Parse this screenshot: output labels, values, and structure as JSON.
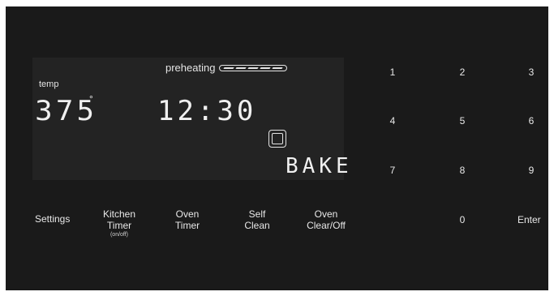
{
  "display": {
    "preheat_label": "preheating",
    "temp_label": "temp",
    "temperature": "375",
    "degree_symbol": "°",
    "clock": "12:30",
    "mode": "BAKE"
  },
  "function_keys": {
    "settings": "Settings",
    "kitchen_timer_line1": "Kitchen",
    "kitchen_timer_line2": "Timer",
    "kitchen_timer_sub": "(on/off)",
    "oven_timer_line1": "Oven",
    "oven_timer_line2": "Timer",
    "self_clean_line1": "Self",
    "self_clean_line2": "Clean",
    "oven_clear_line1": "Oven",
    "oven_clear_line2": "Clear/Off"
  },
  "keypad": {
    "k1": "1",
    "k2": "2",
    "k3": "3",
    "k4": "4",
    "k5": "5",
    "k6": "6",
    "k7": "7",
    "k8": "8",
    "k9": "9",
    "k0": "0",
    "enter": "Enter"
  },
  "colors": {
    "panel": "#1a1a1a",
    "display": "#232323",
    "text": "#e8e8e8"
  },
  "icons": {
    "oven": "oven-icon",
    "preheat": "preheat-progress-bar"
  }
}
